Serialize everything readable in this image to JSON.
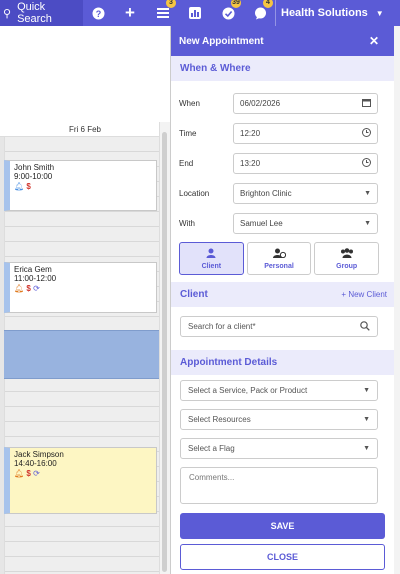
{
  "topbar": {
    "search_label": "Quick Search",
    "icons": [
      {
        "name": "help-icon",
        "glyph": "?"
      },
      {
        "name": "add-icon",
        "glyph": "+"
      },
      {
        "name": "tasks-icon",
        "glyph": "≡",
        "badge": "3"
      },
      {
        "name": "reports-icon",
        "glyph": "▦"
      },
      {
        "name": "check-icon",
        "glyph": "✓",
        "badge": "39"
      },
      {
        "name": "messages-icon",
        "glyph": "●",
        "badge": "4"
      }
    ],
    "org_name": "Health Solutions"
  },
  "calendar": {
    "day_header": "Fri 6 Feb",
    "appointments": [
      {
        "name": "John Smith",
        "time": "9:00-10:00"
      },
      {
        "name": "Erica Gem",
        "time": "11:00-12:00"
      },
      {
        "name": "Jack Simpson",
        "time": "14:40-16:00"
      }
    ]
  },
  "panel": {
    "title": "New Appointment",
    "section_when_where": "When & Where",
    "when_label": "When",
    "when_value": "06/02/2026",
    "time_label": "Time",
    "time_value": "12:20",
    "end_label": "End",
    "end_value": "13:20",
    "location_label": "Location",
    "location_value": "Brighton Clinic",
    "with_label": "With",
    "with_value": "Samuel Lee",
    "tabs": [
      "Client",
      "Personal",
      "Group"
    ],
    "section_client": "Client",
    "new_client": "+ New Client",
    "client_search_placeholder": "Search for a client*",
    "section_details": "Appointment Details",
    "service_placeholder": "Select a Service, Pack or Product",
    "resources_placeholder": "Select Resources",
    "flag_placeholder": "Select a Flag",
    "comments_placeholder": "Comments...",
    "save_label": "SAVE",
    "close_label": "CLOSE"
  },
  "colors": {
    "brand": "#5b5bd6",
    "section_bg": "#ebebfb",
    "blocked": "#98b3df",
    "appt_yellow": "#fdf6c3"
  }
}
